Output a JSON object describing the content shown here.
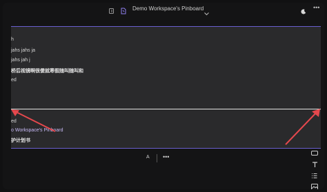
{
  "header": {
    "workspace_title": "Demo Workspace's Pinboard",
    "icons": [
      "pages-icon",
      "pinboard-icon",
      "chevron-down-icon",
      "moon-icon",
      "more-icon"
    ],
    "more_label": "•••"
  },
  "canvas": {
    "lines_top": [
      "h",
      "jahs jahs ja",
      "jahs jah j",
      "桥后视镜啊很傻就寒假随叫随叫和",
      "ed"
    ],
    "lines_bottom": [
      "ed",
      "o Workspace's Pinboard",
      "护计划书"
    ],
    "accent": "#6a5fd0",
    "arrow_color": "#e5484d"
  },
  "toolbar": {
    "text_label": "A",
    "more_label": "•••"
  },
  "right_tools": [
    "note-icon",
    "text-icon",
    "list-icon",
    "image-icon"
  ]
}
